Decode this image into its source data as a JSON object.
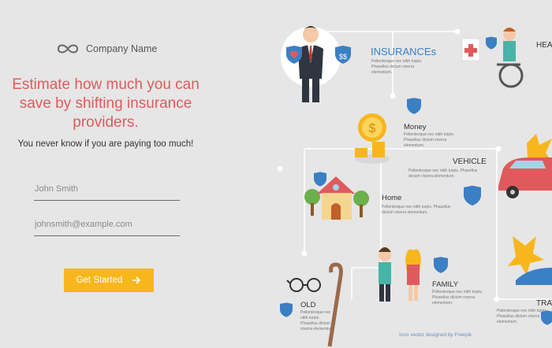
{
  "brand": {
    "name": "Company Name",
    "logo_icon": "infinity-icon"
  },
  "hero": {
    "headline": "Estimate how much you can save by shifting insurance providers.",
    "subheadline": "You never know if you are paying too much!"
  },
  "form": {
    "name_placeholder": "John Smith",
    "email_placeholder": "johnsmith@example.com",
    "cta_label": "Get Started",
    "cta_icon": "arrow-right-icon"
  },
  "infographic": {
    "insurances": {
      "title": "INSURANCEs",
      "desc": "Pellentesque nec nibh turpis. Phasellus dictum viverra elementum."
    },
    "health": {
      "title": "HEAL"
    },
    "money": {
      "title": "Money",
      "desc": "Pellentesque nec nibh turpis. Phasellus dictum viverra elementum."
    },
    "vehicle": {
      "title": "VEHICLE",
      "desc": "Pellentesque nec nibh turpis. Phasellus dictum viverra elementum."
    },
    "home": {
      "title": "Home",
      "desc": "Pellentesque nec nibh turpis. Phasellus dictum viverra elementum."
    },
    "family": {
      "title": "FAMILY",
      "desc": "Pellentesque nec nibh turpis. Phasellus dictum viverra elementum."
    },
    "old": {
      "title": "OLD",
      "desc": "Pellentesque nec nibh turpis. Phasellus dictum viverra elementum."
    },
    "travel": {
      "title": "TRAV",
      "desc": "Pellentesque nec nibh turpis. Phasellus dictum viverra elementum."
    },
    "credit": "Icon vector designed by Freepik"
  },
  "colors": {
    "accent_red": "#e05a5d",
    "cta": "#f8b61d",
    "shield_blue": "#3b7fc4",
    "background": "#e6e6e6"
  }
}
